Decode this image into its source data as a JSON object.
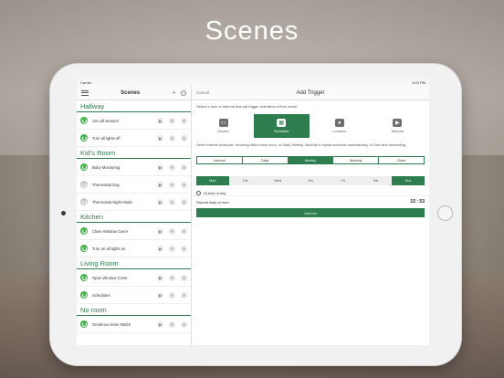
{
  "headline": "Scenes",
  "status": {
    "carrier": "Carrier",
    "time": "3:03 PM",
    "battery": "100%"
  },
  "sidebar": {
    "title": "Scenes",
    "groups": [
      {
        "name": "Hallway",
        "scenes": [
          "Arm all sensors",
          "Turn all lights off"
        ]
      },
      {
        "name": "Kid's Room",
        "scenes": [
          "Baby Monitoring",
          "Thermostat Day",
          "Thermostat Night Mode"
        ]
      },
      {
        "name": "Kitchen",
        "scenes": [
          "Close Window Cover",
          "Turn on all lights on"
        ]
      },
      {
        "name": "Living Room",
        "scenes": [
          "Open Window Cover",
          "Schedules"
        ]
      },
      {
        "name": "No room",
        "scenes": [
          "Geofence Enter NKDS"
        ]
      }
    ]
  },
  "trigger": {
    "cancel": "Cancel",
    "title": "Add Trigger",
    "instruction": "Select a time or interval that will trigger activation of this scene.",
    "tabs": [
      {
        "label": "Device",
        "icon": "tv-icon"
      },
      {
        "label": "Schedule",
        "icon": "calendar-icon"
      },
      {
        "label": "Location",
        "icon": "location-pin-icon"
      },
      {
        "label": "Manual",
        "icon": "play-icon"
      }
    ],
    "active_tab": "Schedule",
    "description": "Select interval (example: recurring video every hour), or Daily, Weekly, Monthly to repeat schedule automatically, or One-time scheduling.",
    "intervals": [
      "Interval",
      "Daily",
      "Weekly",
      "Monthly",
      "Once"
    ],
    "selected_interval": "Weekly",
    "days": [
      "Mon",
      "Tue",
      "Wed",
      "Thu",
      "Fri",
      "Sat",
      "Sun"
    ],
    "selected_days": [
      "Mon",
      "Sun"
    ],
    "at_time_label": "At time of day",
    "repeat_label": "Repeat daily at hour",
    "repeat_time": "15 : 53",
    "validate_label": "Validate"
  }
}
